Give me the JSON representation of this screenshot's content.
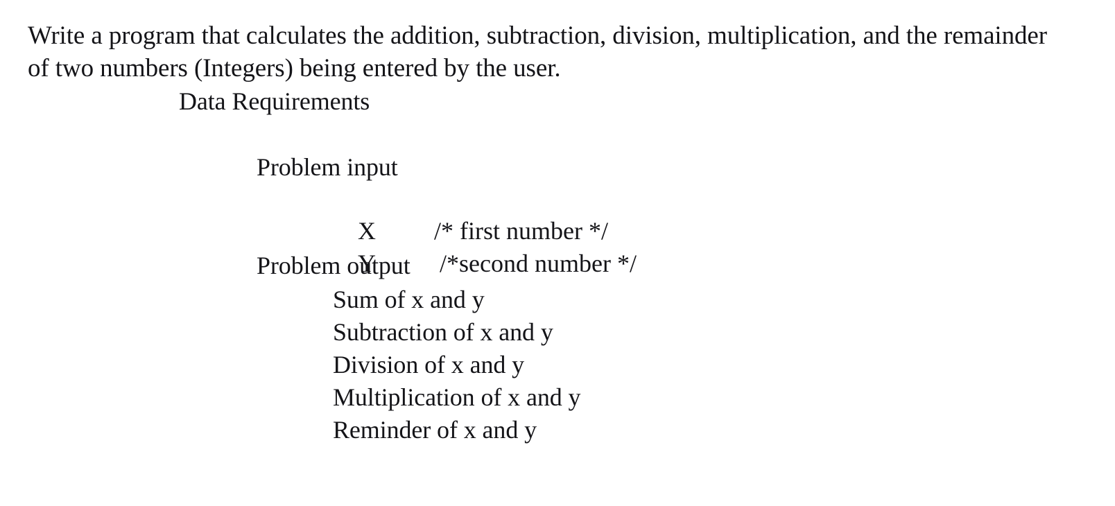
{
  "document": {
    "intro": {
      "line1": "Write a program that calculates the addition, subtraction, division, multiplication, and the remainder",
      "line2": "of two numbers (Integers) being entered by the user."
    },
    "heading": "Data Requirements",
    "sections": [
      {
        "label": "Problem input",
        "variables": [
          {
            "name": "X",
            "comment": "/* first number */"
          },
          {
            "name": "Y",
            "comment": "/*second number */"
          }
        ]
      },
      {
        "label": "Problem output",
        "items": [
          "Sum of x and y",
          "Subtraction of x and y",
          "Division of x and y",
          "Multiplication of x and y",
          "Reminder of x and y"
        ]
      }
    ]
  },
  "style": {
    "text_color": "#141418",
    "background_color": "#ffffff"
  }
}
